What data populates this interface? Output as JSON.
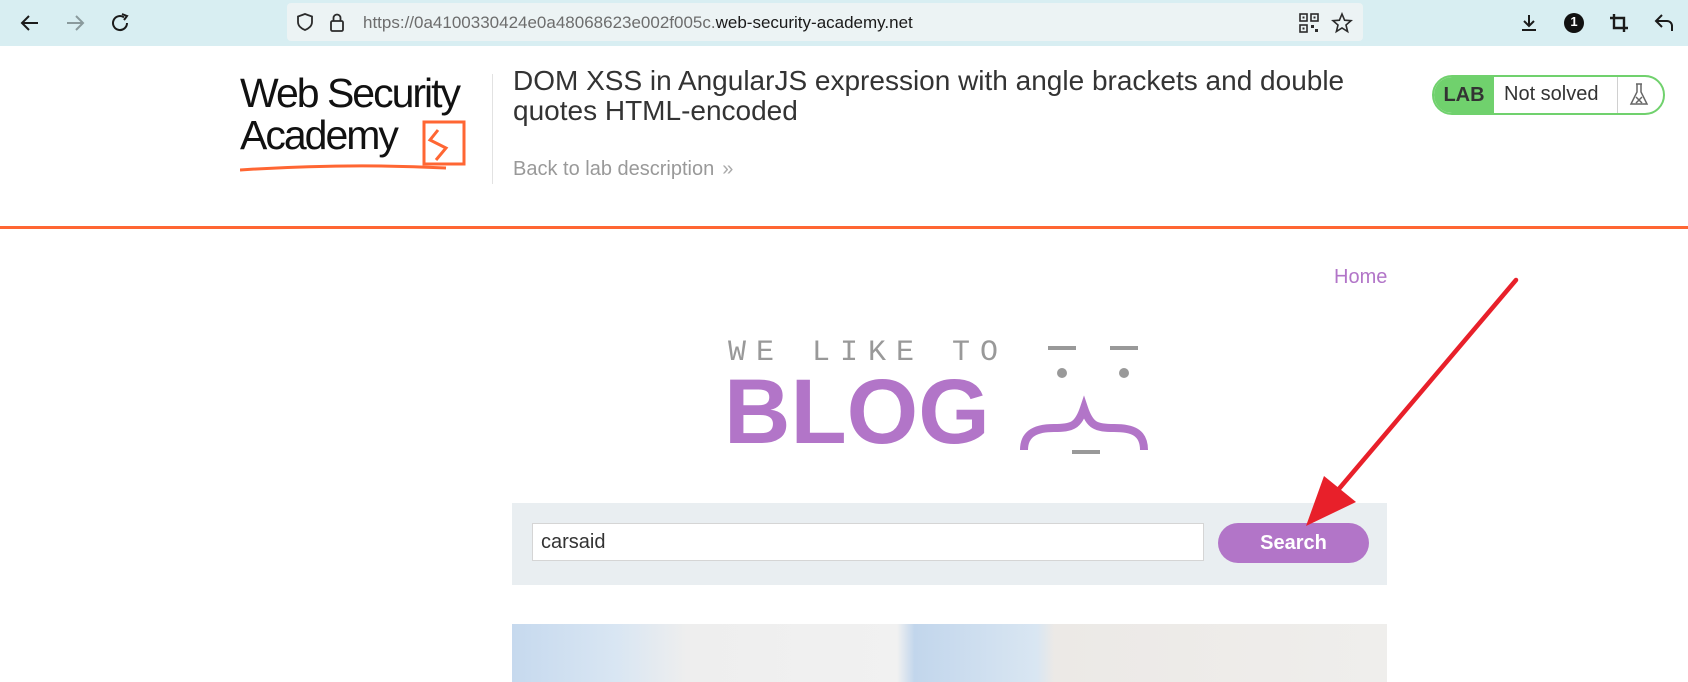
{
  "browser": {
    "url_prefix": "https://0a4100330424e0a48068623e002f005c.",
    "url_domain": "web-security-academy.net",
    "profile_badge": "1"
  },
  "lab": {
    "logo_line1": "Web Security",
    "logo_line2": "Academy",
    "title": "DOM XSS in AngularJS expression with angle brackets and double quotes HTML-encoded",
    "back_link": "Back to lab description",
    "status_badge": "LAB",
    "status_text": "Not solved",
    "accent": "#ff6633",
    "solved_color": "#70d16d"
  },
  "page": {
    "home_link": "Home",
    "hero_tagline": "WE LIKE TO",
    "hero_word": "BLOG",
    "brand_color": "#b275c8"
  },
  "search": {
    "value": "carsaid",
    "button_label": "Search"
  }
}
